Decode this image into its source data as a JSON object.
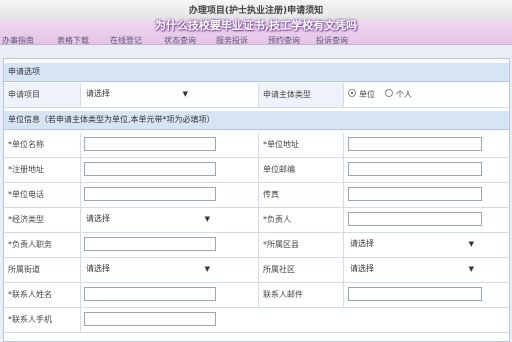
{
  "window_title": "办理项目(护士执业注册)申请须知",
  "overlay_caption": "为什么技校要毕业证书,技工学校有文凭吗",
  "tabs": [
    "办事指南",
    "表格下载",
    "在线登记",
    "状态查询",
    "服务投诉",
    "预约查询",
    "投诉查询",
    "表查投诉"
  ],
  "section1": {
    "title": "申请选项"
  },
  "apply_item": {
    "label": "申请项目",
    "value": "请选择"
  },
  "applicant_type": {
    "label": "申请主体类型",
    "options": [
      "单位",
      "个人"
    ],
    "selected": "单位"
  },
  "section2": {
    "title": "单位信息（若申请主体类型为单位,本单元带*项为必填项）"
  },
  "fields": {
    "unit_name": "*单位名称",
    "unit_address": "*单位地址",
    "reg_address": "*注册地址",
    "postcode": "单位邮编",
    "unit_phone": "*单位电话",
    "fax": "传真",
    "econ_type": "*经济类型",
    "econ_type_value": "请选择",
    "legal_rep": "*负责人",
    "rep_title": "*负责人职务",
    "district": "*所属区县",
    "district_value": "请选择",
    "street": "所属街道",
    "street_value": "请选择",
    "community": "所属社区",
    "community_value": "请选择",
    "contact_name": "*联系人姓名",
    "contact_email": "联系人邮件",
    "contact_mobile": "*联系人手机"
  }
}
